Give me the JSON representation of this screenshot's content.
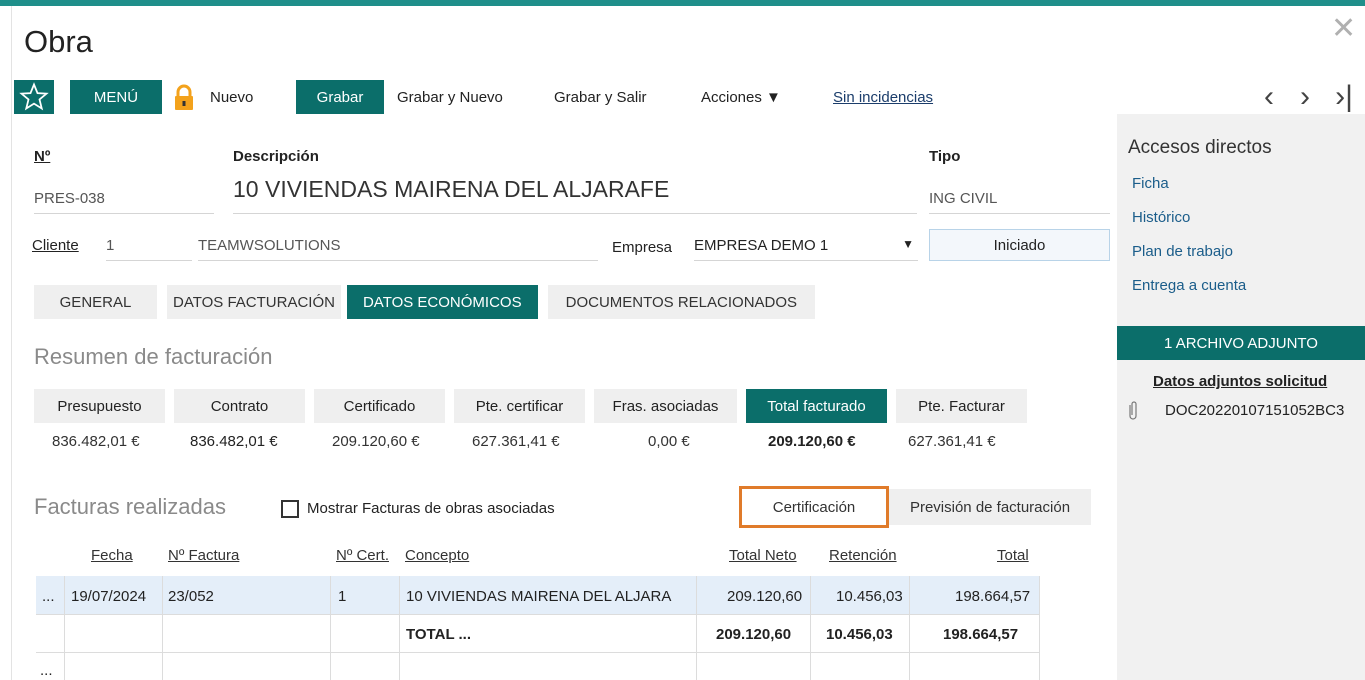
{
  "window": {
    "title": "Obra",
    "close_icon": "close-icon"
  },
  "toolbar": {
    "menu_label": "MENÚ",
    "nuevo": "Nuevo",
    "grabar": "Grabar",
    "grabar_nuevo": "Grabar y Nuevo",
    "grabar_salir": "Grabar y Salir",
    "acciones": "Acciones ▼",
    "sin_incidencias": "Sin incidencias",
    "prev": "‹",
    "next": "›",
    "last": "›|"
  },
  "form": {
    "numero_label": "Nº",
    "numero_value": "PRES-038",
    "descripcion_label": "Descripción",
    "descripcion_value": "10 VIVIENDAS MAIRENA DEL ALJARAFE",
    "tipo_label": "Tipo",
    "tipo_value": "ING CIVIL",
    "cliente_label": "Cliente",
    "cliente_code": "1",
    "cliente_name": "TEAMWSOLUTIONS",
    "empresa_label": "Empresa",
    "empresa_value": "EMPRESA DEMO 1",
    "estado": "Iniciado"
  },
  "tabs": [
    "GENERAL",
    "DATOS FACTURACIÓN",
    "DATOS ECONÓMICOS",
    "DOCUMENTOS RELACIONADOS"
  ],
  "active_tab": "DATOS ECONÓMICOS",
  "resumen": {
    "title": "Resumen de facturación",
    "columns": [
      {
        "label": "Presupuesto",
        "value": "836.482,01 €"
      },
      {
        "label": "Contrato",
        "value": "836.482,01 €"
      },
      {
        "label": "Certificado",
        "value": "209.120,60 €"
      },
      {
        "label": "Pte. certificar",
        "value": "627.361,41 €"
      },
      {
        "label": "Fras. asociadas",
        "value": "0,00 €"
      },
      {
        "label": "Total facturado",
        "value": "209.120,60 €"
      },
      {
        "label": "Pte. Facturar",
        "value": "627.361,41 €"
      }
    ]
  },
  "facturas": {
    "title": "Facturas realizadas",
    "checkbox_label": "Mostrar Facturas de obras asociadas",
    "btn_certificacion": "Certificación",
    "btn_prevision": "Previsión de facturación",
    "headers": {
      "fecha": "Fecha",
      "num": "Nº Factura",
      "cert": "Nº Cert.",
      "concepto": "Concepto",
      "neto": "Total Neto",
      "retencion": "Retención",
      "total": "Total"
    },
    "row": {
      "dots": "...",
      "fecha": "19/07/2024",
      "num": "23/052",
      "cert": "1",
      "concepto": "10 VIVIENDAS MAIRENA DEL ALJARA",
      "neto": "209.120,60",
      "retencion": "10.456,03",
      "total": "198.664,57"
    },
    "totals": {
      "label": "TOTAL ...",
      "neto": "209.120,60",
      "retencion": "10.456,03",
      "total": "198.664,57"
    },
    "more": "..."
  },
  "sidebar": {
    "title": "Accesos directos",
    "links": [
      "Ficha",
      "Histórico",
      "Plan de trabajo",
      "Entrega a cuenta"
    ],
    "attachments_bar": "1 ARCHIVO ADJUNTO",
    "attachments_title": "Datos adjuntos solicitud",
    "attachment_file": "DOC20220107151052BC3"
  },
  "colors": {
    "accent": "#0b6e6a",
    "highlight_row": "#e4eef9",
    "orange_outline": "#e07b2a"
  }
}
